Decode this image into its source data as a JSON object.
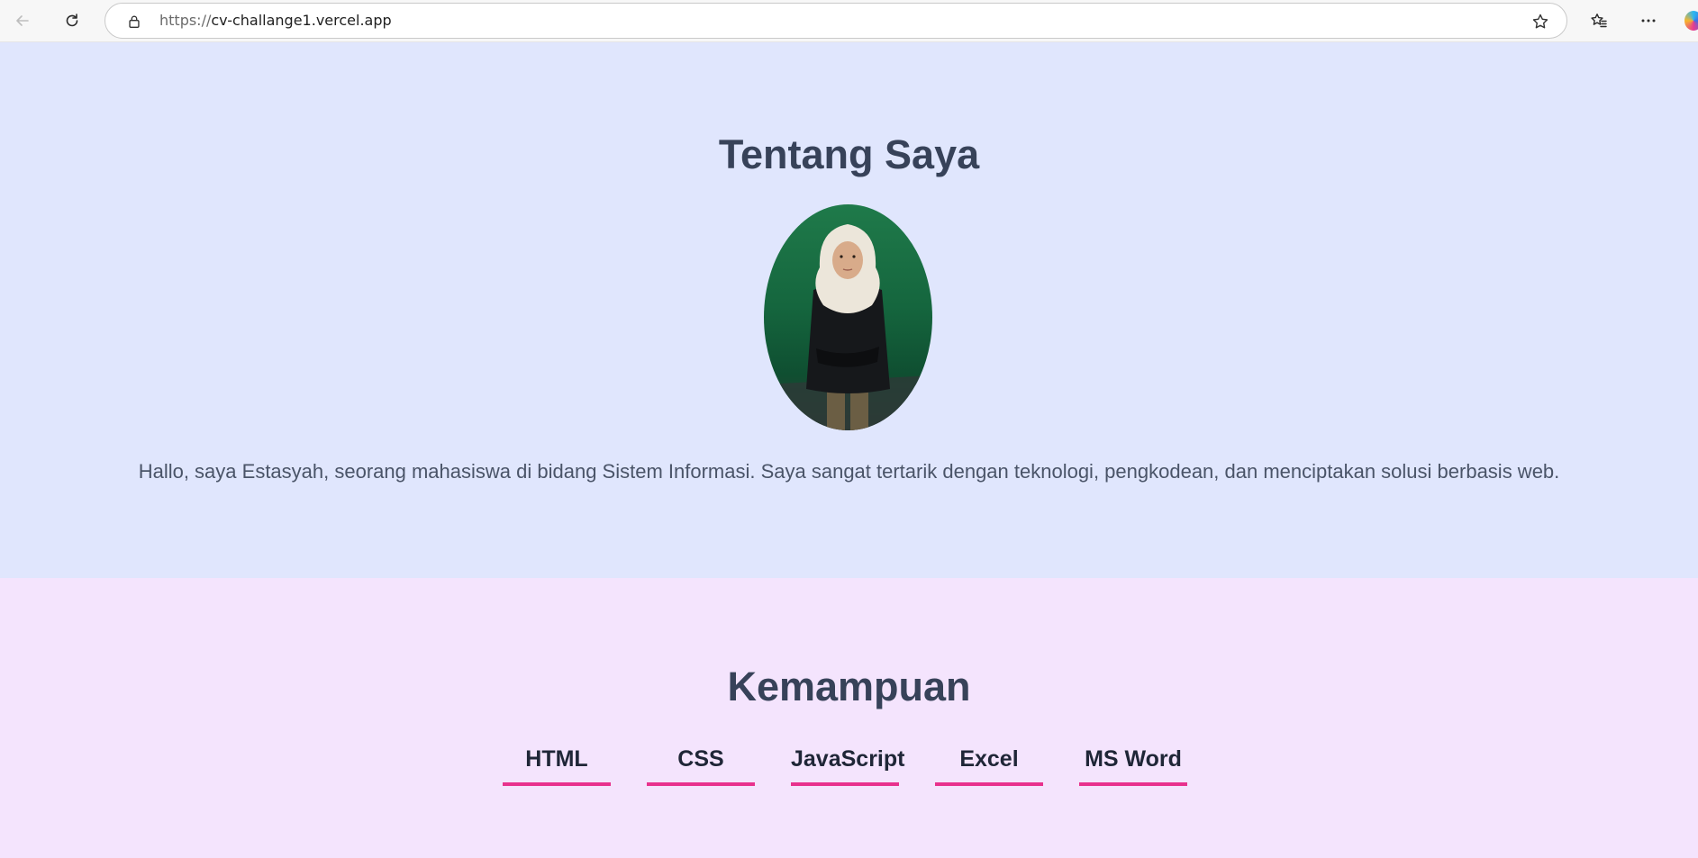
{
  "browser": {
    "url_protocol": "https://",
    "url_host": "cv-challange1.vercel.app",
    "icons": [
      "back-icon",
      "refresh-icon",
      "lock-icon",
      "star-icon",
      "favorites-icon",
      "more-icon",
      "edge-logo"
    ]
  },
  "about": {
    "title": "Tentang Saya",
    "description": "Hallo, saya Estasyah, seorang mahasiswa di bidang Sistem Informasi. Saya sangat tertarik dengan teknologi, pengkodean, dan menciptakan solusi berbasis web."
  },
  "skills": {
    "title": "Kemampuan",
    "items": [
      {
        "label": "HTML"
      },
      {
        "label": "CSS"
      },
      {
        "label": "JavaScript"
      },
      {
        "label": "Excel"
      },
      {
        "label": "MS Word"
      }
    ]
  },
  "colors": {
    "about_bg": "#e0e6fd",
    "skills_bg": "#f4e4fd",
    "heading": "#374259",
    "accent_underline": "#e8318d"
  }
}
